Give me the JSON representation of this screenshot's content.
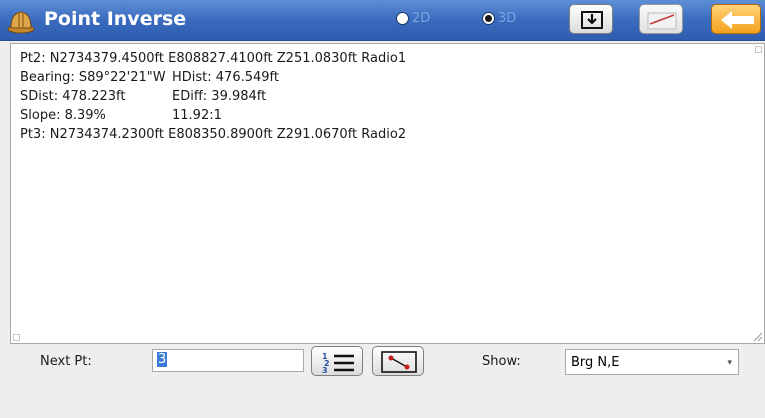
{
  "header": {
    "title": "Point Inverse",
    "mode_options": [
      {
        "label": "2D",
        "selected": false
      },
      {
        "label": "3D",
        "selected": true
      }
    ],
    "icons": {
      "app": "hard-hat-icon",
      "import": "import-tray-icon",
      "edit": "edit-line-icon",
      "back": "back-arrow-icon"
    }
  },
  "results": {
    "lines": [
      {
        "c1": "Pt2: N2734379.4500ft E808827.4100ft Z251.0830ft Radio1"
      },
      {
        "c1": "Bearing: S89°22'21\"W",
        "c2": "HDist: 476.549ft"
      },
      {
        "c1": "SDist: 478.223ft",
        "c2": "EDiff: 39.984ft"
      },
      {
        "c1": "Slope: 8.39%",
        "c2": "11.92:1"
      },
      {
        "c1": "Pt3: N2734374.2300ft E808350.8900ft Z291.0670ft Radio2"
      }
    ]
  },
  "footer": {
    "next_pt_label": "Next Pt:",
    "next_pt_value": "3",
    "list_button_icon": "numbered-list-icon",
    "map_button_icon": "map-points-icon",
    "show_label": "Show:",
    "show_value": "Brg N,E"
  },
  "colors": {
    "titlebar": "#3a6bbf",
    "back_button": "#f4a21b",
    "selection": "#3d7bd8"
  }
}
